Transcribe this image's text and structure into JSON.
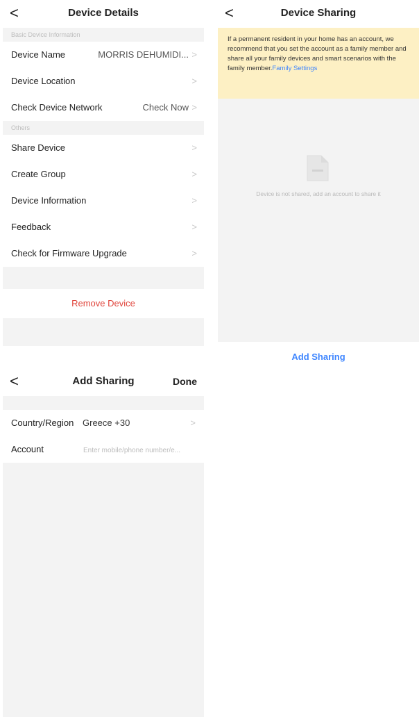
{
  "device_details": {
    "title": "Device Details",
    "back": "<",
    "section_basic": "Basic Device Information",
    "device_name_label": "Device Name",
    "device_name_value": "MORRIS DEHUMIDI...",
    "device_location_label": "Device Location",
    "check_network_label": "Check Device Network",
    "check_network_value": "Check Now",
    "section_others": "Others",
    "items": [
      {
        "label": "Share Device"
      },
      {
        "label": "Create Group"
      },
      {
        "label": "Device Information"
      },
      {
        "label": "Feedback"
      },
      {
        "label": "Check for Firmware Upgrade"
      }
    ],
    "remove_label": "Remove Device",
    "chevron": ">"
  },
  "device_sharing": {
    "title": "Device Sharing",
    "back": "<",
    "notice_text": "If a permanent resident in your home has an account, we recommend that you set the account as a family member and share all your family devices and smart scenarios with the family member.",
    "notice_link": "Family Settings",
    "empty_text": "Device is not shared, add an account to share it",
    "add_button": "Add Sharing"
  },
  "add_sharing": {
    "title": "Add Sharing",
    "back": "<",
    "done": "Done",
    "country_label": "Country/Region",
    "country_value": "Greece +30",
    "account_label": "Account",
    "account_placeholder": "Enter mobile/phone number/e..."
  },
  "colors": {
    "accent": "#3f86ff",
    "danger": "#e0453c",
    "notice_bg": "#fdf0c4"
  },
  "icons": {
    "back": "chevron-left-icon",
    "row": "chevron-right-icon",
    "empty": "document-icon"
  }
}
